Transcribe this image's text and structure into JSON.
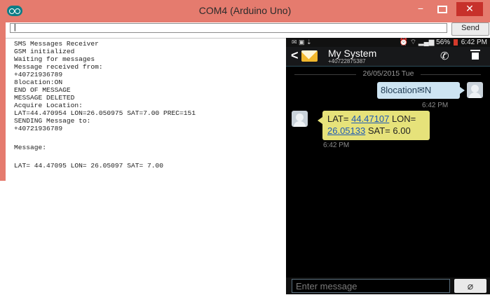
{
  "window": {
    "title": "COM4 (Arduino Uno)",
    "minimize_glyph": "−",
    "close_glyph": "✕",
    "title_color": "#e57b6e",
    "close_color": "#c7312b"
  },
  "serial": {
    "input_value": "|",
    "send_label": "Send",
    "lines": [
      "SMS Messages Receiver",
      "GSM initialized",
      "Waiting for messages",
      "Message received from:",
      "+40721936789",
      "8location:ON",
      "END OF MESSAGE",
      "MESSAGE DELETED",
      "Acquire Location:",
      "LAT=44.470954 LON=26.050975 SAT=7.00 PREC=151",
      "SENDING Message to:",
      "+40721936789",
      "",
      "Message:",
      "",
      "LAT= 44.47095 LON= 26.05097 SAT= 7.00"
    ]
  },
  "phone": {
    "status": {
      "battery": "56%",
      "time": "6:42 PM"
    },
    "appbar": {
      "back_glyph": "<",
      "contact_name": "My System",
      "contact_number": "+40722875387",
      "call_glyph": "✆"
    },
    "date_separator": "26/05/2015 Tue",
    "messages": {
      "outgoing": {
        "text": "8location✉N",
        "time": "6:42 PM"
      },
      "incoming": {
        "lat_label": "LAT=",
        "lat_value": "44.47107",
        "lon_label": "LON=",
        "lon_value": "26.05133",
        "sat_text": "SAT= 6.00",
        "time": "6:42 PM"
      }
    },
    "composer": {
      "placeholder": "Enter message",
      "attach_glyph": "⌀"
    }
  }
}
